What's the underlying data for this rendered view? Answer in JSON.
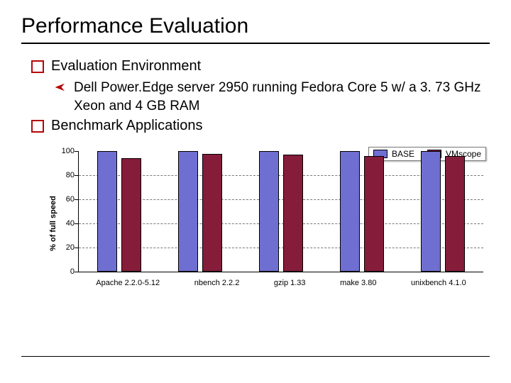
{
  "title": "Performance Evaluation",
  "bullets": {
    "env_label": "Evaluation Environment",
    "env_detail": "Dell Power.Edge server 2950 running Fedora Core 5 w/ a 3. 73 GHz Xeon and 4 GB RAM",
    "bench_label": "Benchmark Applications"
  },
  "chart_data": {
    "type": "bar",
    "ylabel": "% of full speed",
    "ylim": [
      0,
      100
    ],
    "yticks": [
      0,
      20,
      40,
      60,
      80,
      100
    ],
    "categories": [
      "Apache 2.2.0-5.12",
      "nbench 2.2.2",
      "gzip 1.33",
      "make 3.80",
      "unixbench 4.1.0"
    ],
    "series": [
      {
        "name": "BASE",
        "color": "#6f6fd1",
        "values": [
          100,
          100,
          100,
          100,
          100
        ]
      },
      {
        "name": "VMscope",
        "color": "#851c3a",
        "values": [
          94,
          98,
          97,
          96,
          96
        ]
      }
    ]
  }
}
